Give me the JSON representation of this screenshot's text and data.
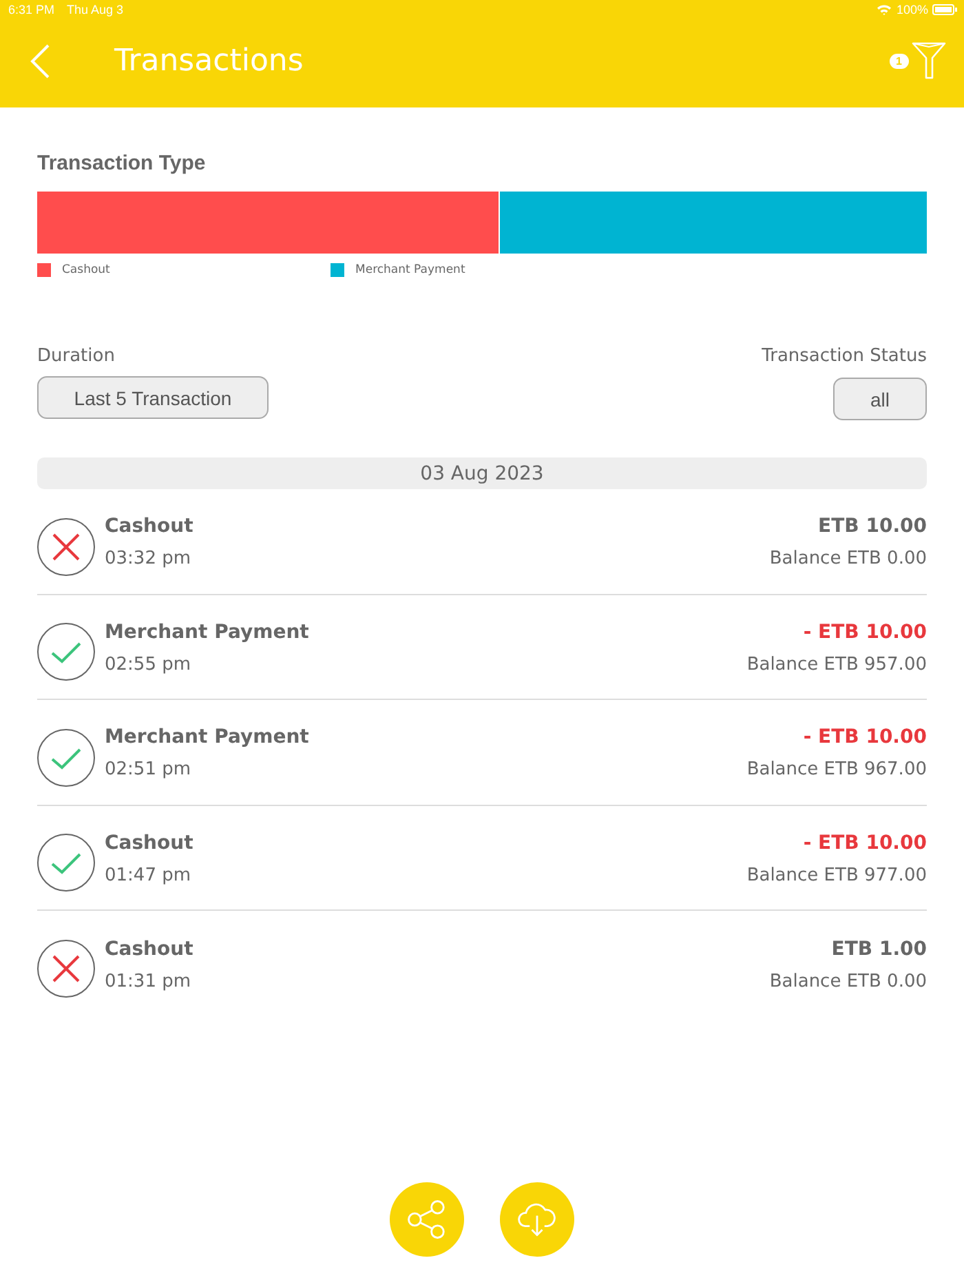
{
  "status_bar": {
    "time": "6:31 PM",
    "date": "Thu Aug 3",
    "battery": "100%"
  },
  "header": {
    "title": "Transactions",
    "filter_count": "1"
  },
  "transaction_type": {
    "title": "Transaction Type",
    "level": 0.52,
    "segments": [
      {
        "label": "Cashout",
        "color": "#ff4d4d"
      },
      {
        "label": "Merchant Payment",
        "color": "#00b4d2"
      }
    ]
  },
  "filters": {
    "duration": {
      "label": "Duration",
      "value": "Last 5 Transaction"
    },
    "status": {
      "label": "Transaction Status",
      "value": "all"
    }
  },
  "groups": [
    {
      "date": "03 Aug 2023",
      "transactions": [
        {
          "type": "Cashout",
          "time": "03:32 pm",
          "amount": "ETB 10.00",
          "balance": "Balance ETB 0.00",
          "failed": true
        },
        {
          "type": "Merchant Payment",
          "time": "02:55 pm",
          "amount": "- ETB 10.00",
          "balance": "Balance ETB 957.00",
          "failed": false
        },
        {
          "type": "Merchant Payment",
          "time": "02:51 pm",
          "amount": "- ETB 10.00",
          "balance": "Balance ETB 967.00",
          "failed": false
        },
        {
          "type": "Cashout",
          "time": "01:47 pm",
          "amount": "- ETB 10.00",
          "balance": "Balance ETB 977.00",
          "failed": false
        },
        {
          "type": "Cashout",
          "time": "01:31 pm",
          "amount": "ETB 1.00",
          "balance": "Balance ETB 0.00",
          "failed": true
        }
      ]
    }
  ],
  "actions": [
    {
      "kind": "share"
    },
    {
      "kind": "download"
    }
  ]
}
